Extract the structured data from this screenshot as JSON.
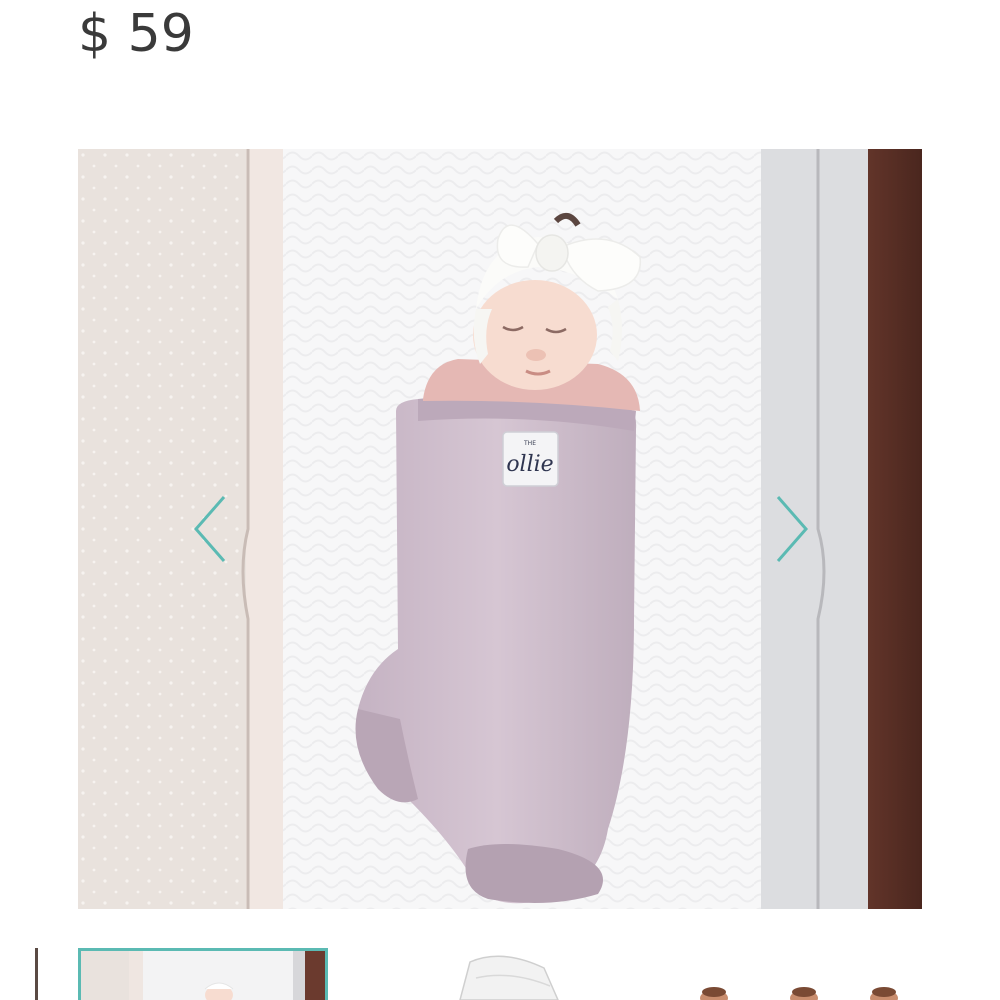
{
  "product": {
    "price": "$ 59"
  },
  "gallery": {
    "main_image_label": "ollie",
    "main_image_label_small": "THE",
    "prev_icon": "chevron-left-icon",
    "next_icon": "chevron-right-icon",
    "accent_color": "#5bbab3",
    "thumbnail_count": 3,
    "active_thumbnail": 1
  }
}
